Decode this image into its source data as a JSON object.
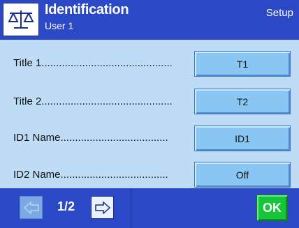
{
  "header": {
    "title": "Identification",
    "subtitle": "User 1",
    "mode": "Setup",
    "icon": "balance-scale-icon"
  },
  "rows": [
    {
      "label": "Title 1",
      "value": "T1"
    },
    {
      "label": "Title 2",
      "value": "T2"
    },
    {
      "label": "ID1 Name",
      "value": "ID1"
    },
    {
      "label": "ID2 Name",
      "value": "Off"
    }
  ],
  "footer": {
    "page": "1/2",
    "prev_icon": "arrow-left-icon",
    "next_icon": "arrow-right-icon",
    "ok_label": "OK"
  },
  "colors": {
    "header_bg": "#2b49c7",
    "content_bg": "#bfdcf6",
    "button_bg": "#89c6f3",
    "ok_bg": "#16c53a"
  }
}
